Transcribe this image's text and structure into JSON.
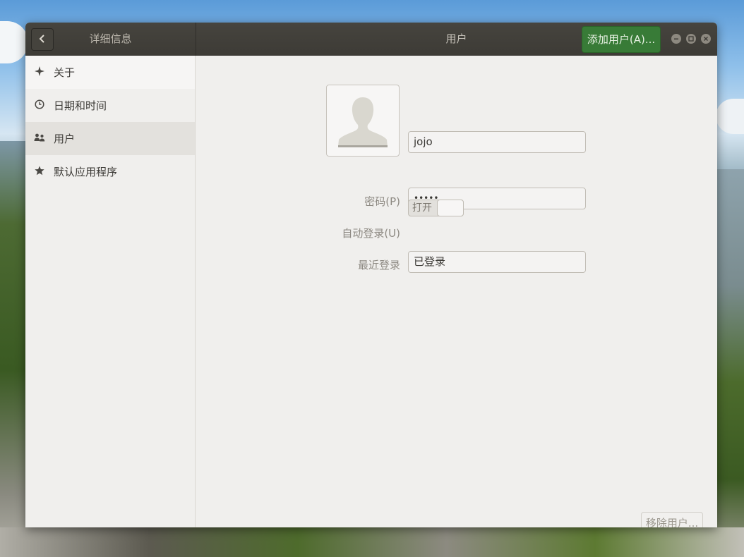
{
  "header": {
    "left_title": "详细信息",
    "title": "用户",
    "add_user_label": "添加用户(A)..."
  },
  "sidebar": {
    "items": [
      {
        "label": "关于",
        "icon": "sparkle-icon"
      },
      {
        "label": "日期和时间",
        "icon": "clock-icon"
      },
      {
        "label": "用户",
        "icon": "users-icon",
        "active": true
      },
      {
        "label": "默认应用程序",
        "icon": "star-icon"
      }
    ]
  },
  "user": {
    "name": "jojo",
    "password_label": "密码(P)",
    "password_value": "•••••",
    "autologin_label": "自动登录(U)",
    "autologin_state": "打开",
    "last_login_label": "最近登录",
    "last_login_value": "已登录"
  },
  "footer": {
    "remove_user_label": "移除用户..."
  },
  "colors": {
    "accent": "#387b37",
    "headerbar": "#3d3b36"
  }
}
